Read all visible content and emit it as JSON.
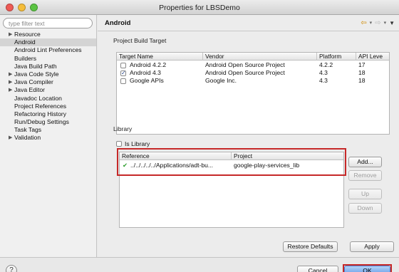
{
  "window": {
    "title": "Properties for LBSDemo"
  },
  "filter": {
    "placeholder": "type filter text"
  },
  "tree": {
    "items": [
      {
        "label": "Resource",
        "expandable": true
      },
      {
        "label": "Android",
        "expandable": false,
        "selected": true
      },
      {
        "label": "Android Lint Preferences",
        "expandable": false
      },
      {
        "label": "Builders",
        "expandable": false
      },
      {
        "label": "Java Build Path",
        "expandable": false
      },
      {
        "label": "Java Code Style",
        "expandable": true
      },
      {
        "label": "Java Compiler",
        "expandable": true
      },
      {
        "label": "Java Editor",
        "expandable": true
      },
      {
        "label": "Javadoc Location",
        "expandable": false
      },
      {
        "label": "Project References",
        "expandable": false
      },
      {
        "label": "Refactoring History",
        "expandable": false
      },
      {
        "label": "Run/Debug Settings",
        "expandable": false
      },
      {
        "label": "Task Tags",
        "expandable": false
      },
      {
        "label": "Validation",
        "expandable": true
      }
    ]
  },
  "page": {
    "title": "Android"
  },
  "build_target": {
    "group_label": "Project Build Target",
    "columns": [
      "Target Name",
      "Vendor",
      "Platform",
      "API Leve"
    ],
    "rows": [
      {
        "checked": false,
        "name": "Android 4.2.2",
        "vendor": "Android Open Source Project",
        "platform": "4.2.2",
        "api": "17"
      },
      {
        "checked": true,
        "name": "Android 4.3",
        "vendor": "Android Open Source Project",
        "platform": "4.3",
        "api": "18"
      },
      {
        "checked": false,
        "name": "Google APIs",
        "vendor": "Google Inc.",
        "platform": "4.3",
        "api": "18"
      }
    ]
  },
  "library": {
    "group_label": "Library",
    "is_library_label": "Is Library",
    "is_library_checked": false,
    "columns": [
      "Reference",
      "Project"
    ],
    "rows": [
      {
        "reference": "../../../../../Applications/adt-bu...",
        "project": "google-play-services_lib",
        "status_icon": "check-icon"
      }
    ],
    "buttons": {
      "add": "Add...",
      "remove": "Remove",
      "up": "Up",
      "down": "Down"
    }
  },
  "actions": {
    "restore_defaults": "Restore Defaults",
    "apply": "Apply",
    "cancel": "Cancel",
    "ok": "OK"
  },
  "icons": {
    "help": "?",
    "back_arrow": "⇦",
    "forward_arrow": "⇨",
    "dropdown": "▾",
    "menu_triangle": "▼"
  },
  "colors": {
    "highlight": "#c62828",
    "selection": "#d4d4d4",
    "primary_button": "#5b97e8"
  }
}
